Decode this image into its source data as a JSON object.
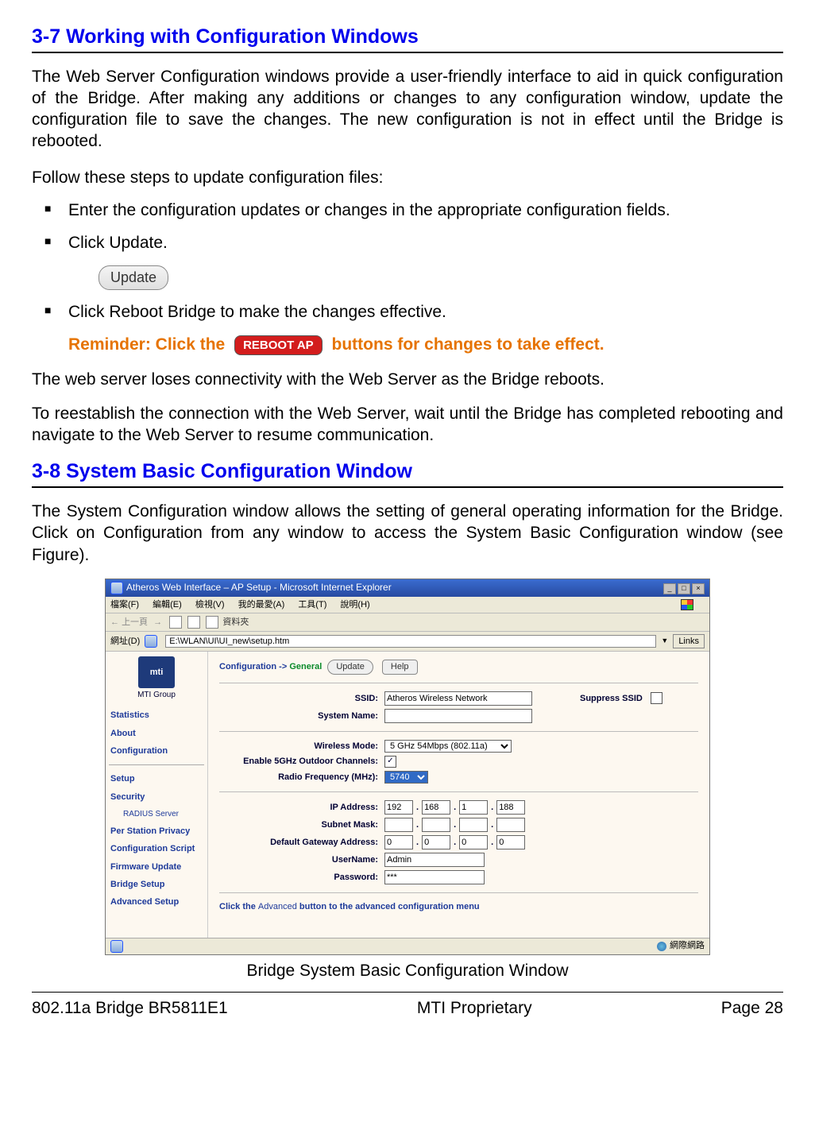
{
  "section37_title": "3-7 Working with Configuration Windows",
  "section37_para1": "The Web Server Configuration windows provide a user-friendly interface to aid in quick configuration of the Bridge. After making any additions or changes to any configuration window, update the configuration file to save the changes. The new configuration is not in effect until the Bridge is rebooted.",
  "section37_intro": "Follow these steps to update configuration files:",
  "step1": "Enter the configuration updates or changes in the appropriate configuration fields.",
  "step2": "Click Update.",
  "update_btn": "Update",
  "step3": "Click Reboot Bridge to make the changes effective.",
  "reminder_pre": "Reminder: Click the",
  "reboot_btn": "REBOOT AP",
  "reminder_post": "buttons for changes to take effect.",
  "para_loses": "The web server loses connectivity with the Web Server as the Bridge reboots.",
  "para_reestablish": "To reestablish the connection with the Web Server, wait until the Bridge has completed rebooting and navigate to the Web Server to resume communication.",
  "section38_title": "3-8 System Basic Configuration Window",
  "section38_para1": "The System Configuration window allows the setting of general operating information for the Bridge. Click on Configuration from any window to access the System Basic Configuration window (see Figure).",
  "screenshot": {
    "title": "Atheros Web Interface – AP Setup - Microsoft Internet Explorer",
    "menu": [
      "檔案(F)",
      "編輯(E)",
      "檢視(V)",
      "我的最愛(A)",
      "工具(T)",
      "說明(H)"
    ],
    "toolbar_back": "上一頁",
    "toolbar_folder": "資料夾",
    "addr_label": "網址(D)",
    "addr_value": "E:\\WLAN\\UI\\UI_new\\setup.htm",
    "links_label": "Links",
    "sidebar": {
      "logo": "mti",
      "group": "MTI Group",
      "items_top": [
        "Statistics",
        "About",
        "Configuration"
      ],
      "items_mid": [
        "Setup",
        "Security"
      ],
      "radius": "RADIUS Server",
      "items_bottom": [
        "Per Station Privacy",
        "Configuration Script",
        "Firmware Update",
        "Bridge Setup",
        "Advanced Setup"
      ]
    },
    "conf": {
      "nav": "Configuration ->",
      "general": "General",
      "update": "Update",
      "help": "Help",
      "ssid_label": "SSID:",
      "ssid_value": "Atheros Wireless Network",
      "suppress_label": "Suppress SSID",
      "sysname_label": "System Name:",
      "wmode_label": "Wireless Mode:",
      "wmode_value": "5 GHz 54Mbps (802.11a)",
      "outdoor_label": "Enable 5GHz Outdoor Channels:",
      "outdoor_checked": true,
      "freq_label": "Radio Frequency (MHz):",
      "freq_value": "5740",
      "ip_label": "IP Address:",
      "ip": [
        "192",
        "168",
        "1",
        "188"
      ],
      "mask_label": "Subnet Mask:",
      "mask": [
        "",
        "",
        "",
        ""
      ],
      "gw_label": "Default Gateway Address:",
      "gw": [
        "0",
        "0",
        "0",
        "0"
      ],
      "user_label": "UserName:",
      "user_value": "Admin",
      "pass_label": "Password:",
      "pass_value": "***",
      "adv_pre": "Click the",
      "adv_btn": "Advanced",
      "adv_post": "button to the advanced configuration menu"
    },
    "status_right": "網際網路"
  },
  "caption": "Bridge System Basic Configuration Window",
  "footer_left": "802.11a Bridge BR5811E1",
  "footer_center": "MTI Proprietary",
  "footer_right": "Page 28"
}
